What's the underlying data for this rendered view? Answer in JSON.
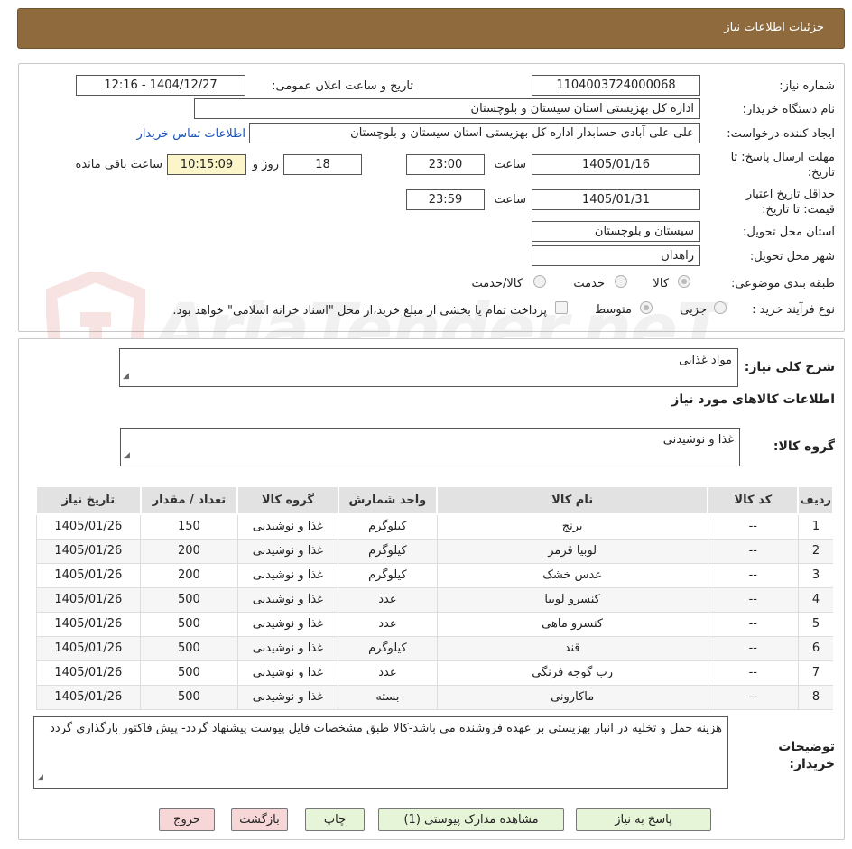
{
  "header": {
    "title": "جزئیات اطلاعات نیاز"
  },
  "info": {
    "need_number_label": "شماره نیاز:",
    "need_number": "1104003724000068",
    "announce_label": "تاریخ و ساعت اعلان عمومی:",
    "announce_value": "1404/12/27 - 12:16",
    "buyer_org_label": "نام دستگاه خریدار:",
    "buyer_org": "اداره کل بهزیستی استان سیستان و بلوچستان",
    "requester_label": "ایجاد کننده درخواست:",
    "requester": "علی علی آبادی حسابدار اداره کل بهزیستی استان سیستان و بلوچستان",
    "contact_link": "اطلاعات تماس خریدار",
    "deadline_label": "مهلت ارسال پاسخ: تا تاریخ:",
    "deadline_date": "1405/01/16",
    "time_label": "ساعت",
    "deadline_time": "23:00",
    "days": "18",
    "days_label": "روز و",
    "remaining_time": "10:15:09",
    "remaining_label": "ساعت باقی مانده",
    "validity_label": "حداقل تاریخ اعتبار قیمت: تا تاریخ:",
    "validity_date": "1405/01/31",
    "validity_time": "23:59",
    "province_label": "استان محل تحویل:",
    "province": "سیستان و بلوچستان",
    "city_label": "شهر محل تحویل:",
    "city": "زاهدان",
    "category_label": "طبقه بندی موضوعی:",
    "category_options": [
      "کالا",
      "خدمت",
      "کالا/خدمت"
    ],
    "process_label": "نوع فرآیند خرید :",
    "process_options": [
      "جزیی",
      "متوسط"
    ],
    "payment_note": "پرداخت تمام یا بخشی از مبلغ خرید،از محل \"اسناد خزانه اسلامی\" خواهد بود."
  },
  "watermark": {
    "text": "AriaTender.neT"
  },
  "details": {
    "summary_label": "شرح کلی نیاز:",
    "summary": "مواد غذایی",
    "goods_info_title": "اطلاعات کالاهای مورد نیاز",
    "group_label": "گروه کالا:",
    "group_value": "غذا و نوشیدنی",
    "table": {
      "headers": [
        "ردیف",
        "کد کالا",
        "نام کالا",
        "واحد شمارش",
        "گروه کالا",
        "تعداد / مقدار",
        "تاریخ نیاز"
      ],
      "rows": [
        [
          "1",
          "--",
          "برنج",
          "کیلوگرم",
          "غذا و نوشیدنی",
          "150",
          "1405/01/26"
        ],
        [
          "2",
          "--",
          "لوبیا قرمز",
          "کیلوگرم",
          "غذا و نوشیدنی",
          "200",
          "1405/01/26"
        ],
        [
          "3",
          "--",
          "عدس خشک",
          "کیلوگرم",
          "غذا و نوشیدنی",
          "200",
          "1405/01/26"
        ],
        [
          "4",
          "--",
          "کنسرو لوبیا",
          "عدد",
          "غذا و نوشیدنی",
          "500",
          "1405/01/26"
        ],
        [
          "5",
          "--",
          "کنسرو ماهی",
          "عدد",
          "غذا و نوشیدنی",
          "500",
          "1405/01/26"
        ],
        [
          "6",
          "--",
          "قند",
          "کیلوگرم",
          "غذا و نوشیدنی",
          "500",
          "1405/01/26"
        ],
        [
          "7",
          "--",
          "رب گوجه فرنگی",
          "عدد",
          "غذا و نوشیدنی",
          "500",
          "1405/01/26"
        ],
        [
          "8",
          "--",
          "ماکارونی",
          "بسته",
          "غذا و نوشیدنی",
          "500",
          "1405/01/26"
        ]
      ]
    },
    "buyer_notes_label": "توضیحات خریدار:",
    "buyer_notes": "هزینه حمل و تخلیه در انبار بهزیستی بر عهده فروشنده می باشد-کالا طبق مشخصات فایل پیوست پیشنهاد گردد- پیش فاکتور بارگذاری گردد"
  },
  "buttons": {
    "reply": "پاسخ به نیاز",
    "attachments": "مشاهده مدارک پیوستی (1)",
    "print": "چاپ",
    "back": "بازگشت",
    "exit": "خروج"
  }
}
